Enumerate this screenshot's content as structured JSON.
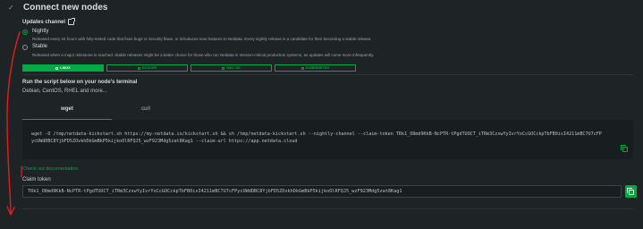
{
  "section": {
    "collapse_icon": "chevron-down-icon",
    "title": "Connect new nodes"
  },
  "updates_channel": {
    "label": "Updates channel",
    "icon": "external-link-icon",
    "options": [
      {
        "label": "Nightly",
        "selected": true,
        "description": "Released every 24 hours with fully-tested code that fixes bugs or security flaws, or introduces new features to Netdata. Every nightly release is a candidate for then becoming a stable release."
      },
      {
        "label": "Stable",
        "selected": false,
        "description": "Released when a major milestone is reached. Stable releases might be a better choice for those who run Netdata in mission-critical production systems, as updates will come more infrequently."
      }
    ]
  },
  "os_tabs": [
    {
      "label": "LINUX",
      "icon": "linux-icon",
      "active": true
    },
    {
      "label": "DOCKER",
      "icon": "docker-icon",
      "active": false
    },
    {
      "label": "MAC OS",
      "icon": "apple-icon",
      "active": false
    },
    {
      "label": "KUBERNETES",
      "icon": "kubernetes-icon",
      "active": false
    }
  ],
  "run": {
    "title": "Run the script below on your node's terminal",
    "subtitle": "Debian, CentOS, RHEL and more..."
  },
  "command_tabs": [
    {
      "label": "wget",
      "active": true
    },
    {
      "label": "curl",
      "active": false
    }
  ],
  "command": {
    "text": "wget -O /tmp/netdata-kickstart.sh https://my-netdata.io/kickstart.sh && sh /tmp/netdata-kickstart.sh --nightly-channel --claim-token TRk1_O8md9KkB-NcPTR-tPgdTUOCT_iTRm3CzswYyIvrYoCcGOCckpTbFB0isI4211mBC7U7cFPycUWdDBC8YjbFD5ZOvkhDkGmBkP5kijkoOlRFQJ5_wzF923Mdg5zat8Kag1 --claim-url https://app.netdata.cloud",
    "copy_icon": "copy-icon"
  },
  "claim": {
    "docs_link": "Check out documentation",
    "label": "Claim token",
    "value": "TRk1_O8md9KkB-NcPTR-tPgdTUOCT_iTRm3CzswYyIvrYoCcGOCckpTbFB0isI4211mBC7U7cFPycUWdDBC8YjbFD5ZOvkhDkGmBkP5kijkoOlRFQJ5_wzF923Mdg5zat8Kag1",
    "copy_icon": "copy-icon"
  },
  "colors": {
    "background": "#1e2326",
    "accent": "#00ab44",
    "annotation": "#e0201b"
  }
}
